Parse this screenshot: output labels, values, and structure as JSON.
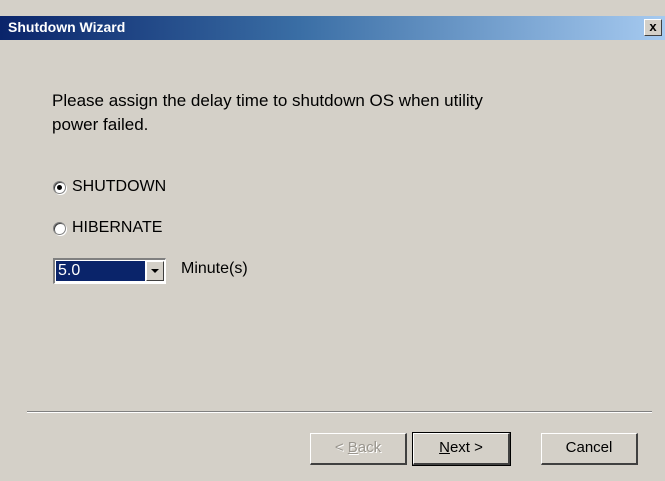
{
  "window": {
    "title": "Shutdown Wizard",
    "close_label": "x"
  },
  "prompt": {
    "line1": "Please assign the delay time to shutdown OS when utility",
    "line2": "power failed."
  },
  "options": {
    "shutdown": {
      "label": "SHUTDOWN",
      "checked": true
    },
    "hibernate": {
      "label": "HIBERNATE",
      "checked": false
    }
  },
  "delay": {
    "value": "5.0",
    "unit_label": "Minute(s)"
  },
  "buttons": {
    "back": {
      "prefix": "< ",
      "accel": "B",
      "rest": "ack"
    },
    "next": {
      "accel": "N",
      "rest": "ext >"
    },
    "cancel": "Cancel"
  }
}
